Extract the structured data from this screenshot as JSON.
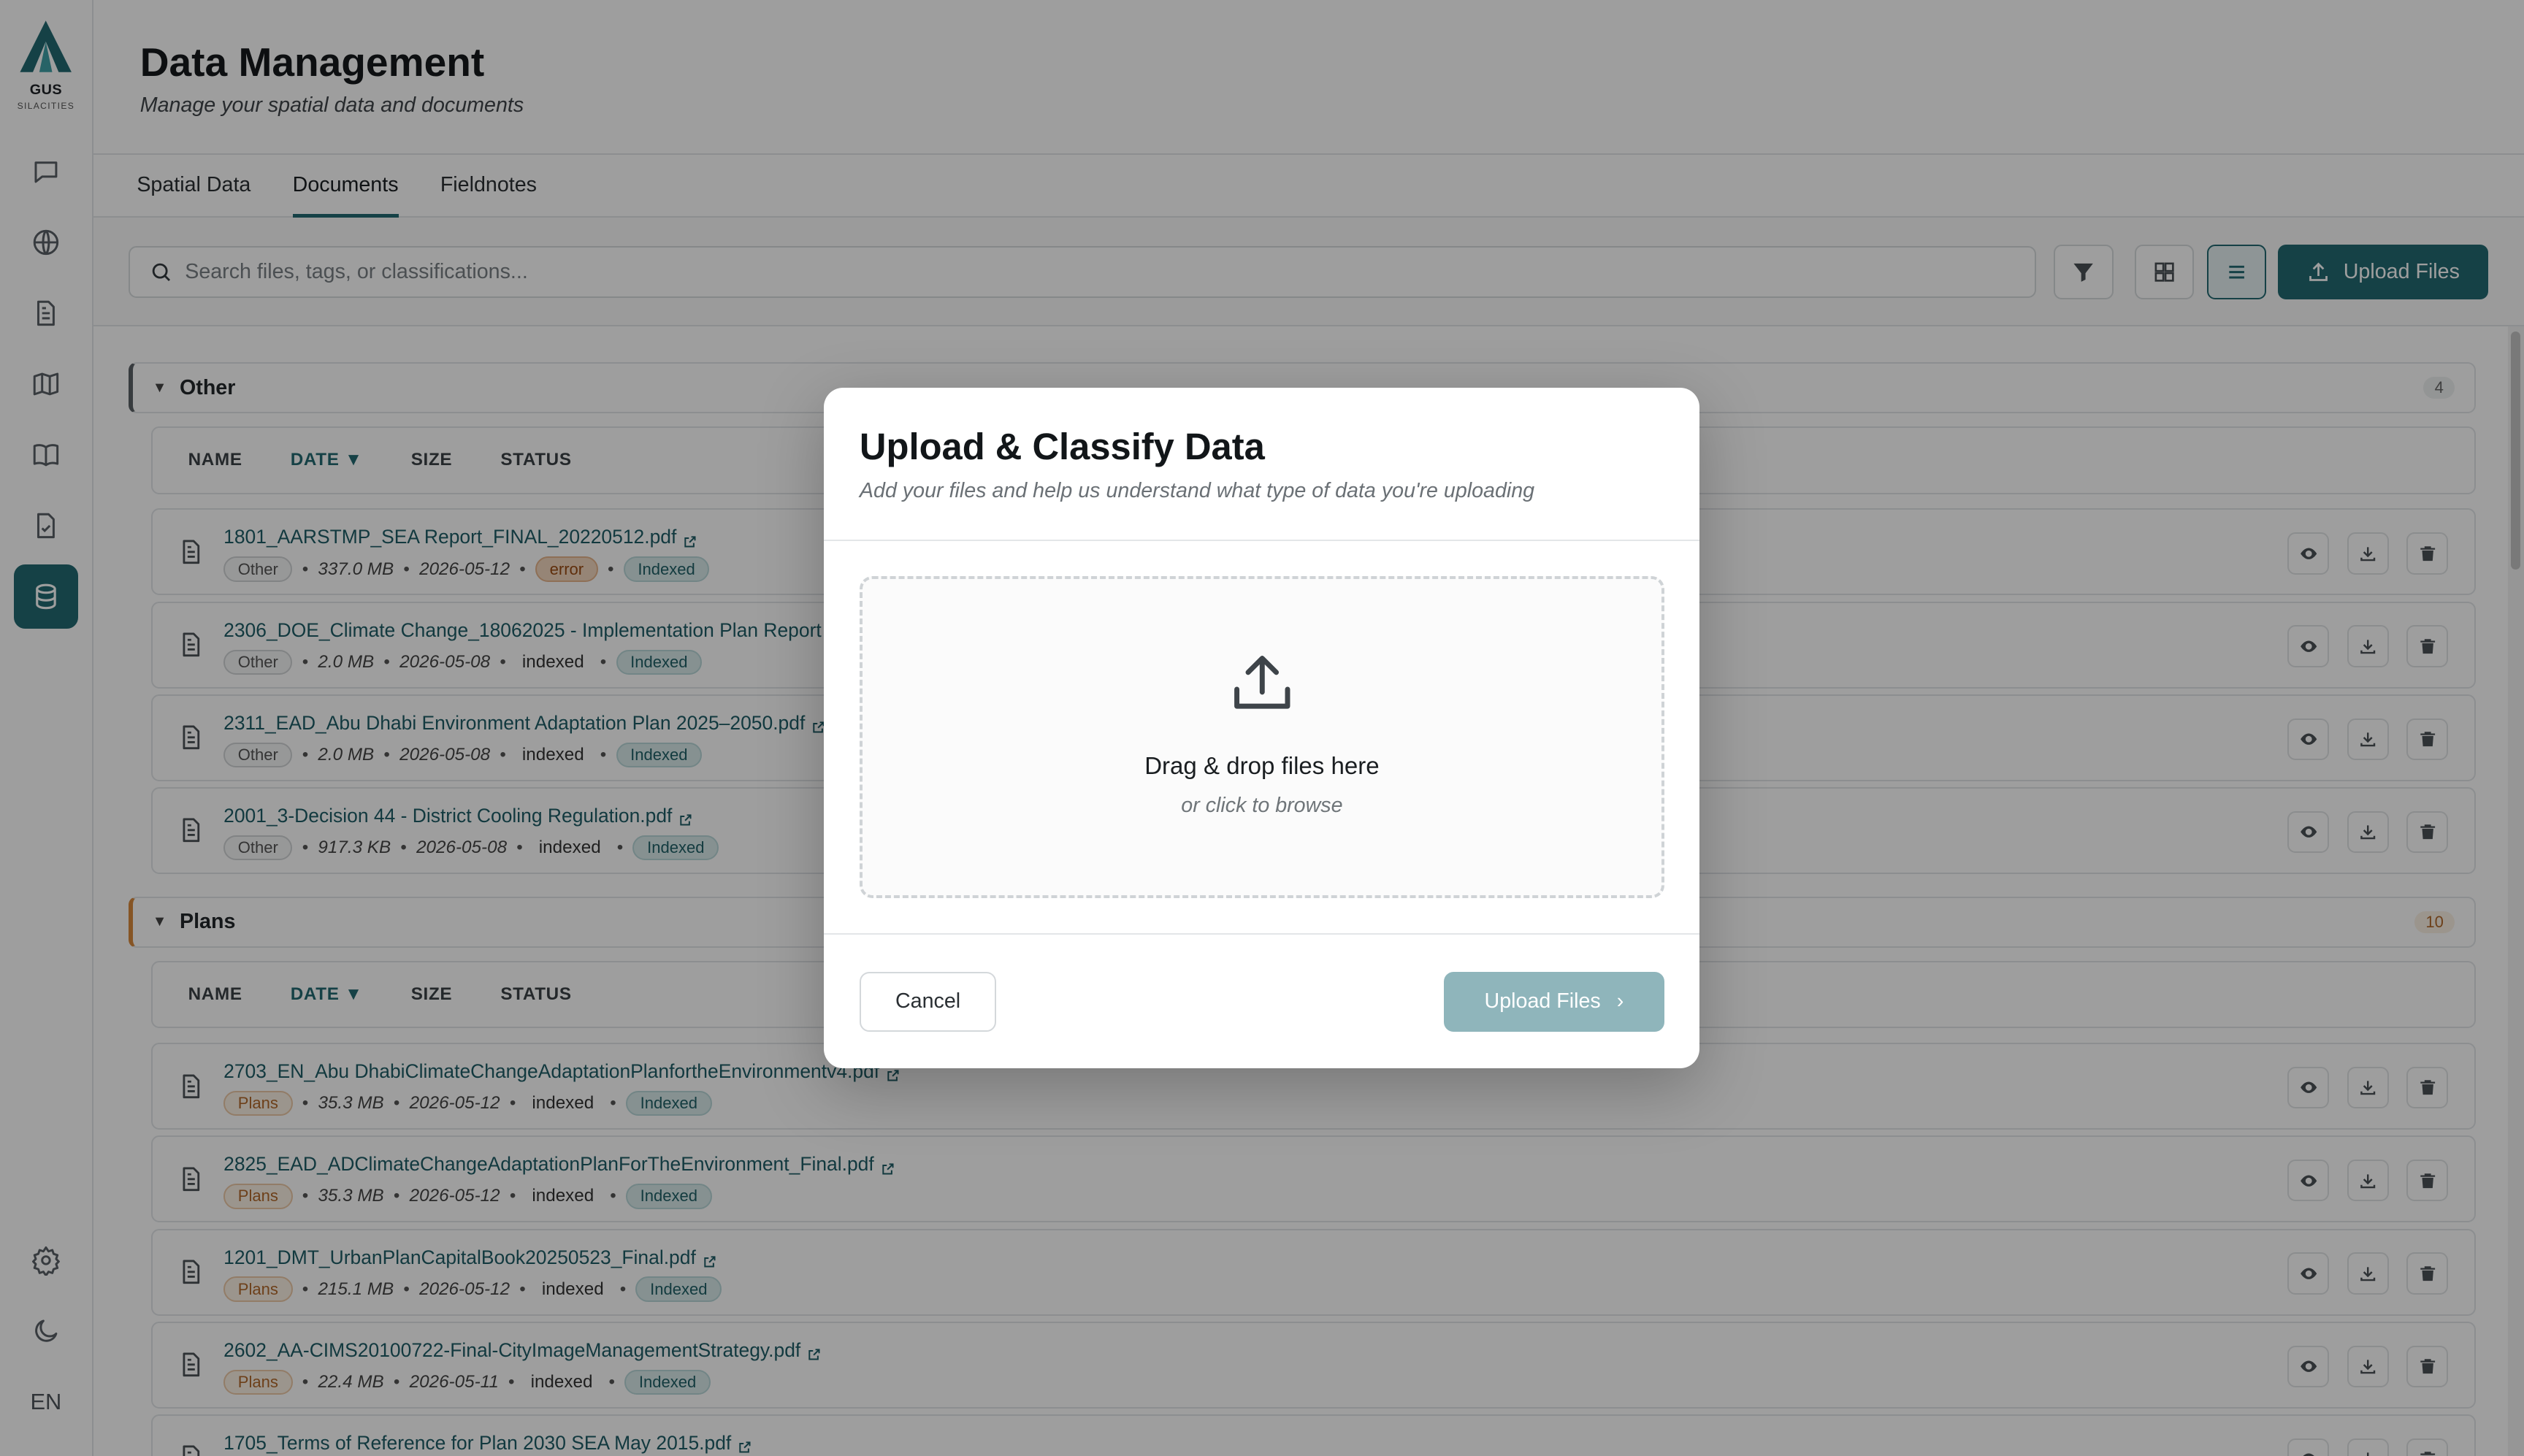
{
  "brand": {
    "name": "GUS",
    "tagline": "SILACITIES"
  },
  "sidebar": {
    "items": [
      {
        "icon": "chat-icon"
      },
      {
        "icon": "globe-icon"
      },
      {
        "icon": "document-icon"
      },
      {
        "icon": "map-icon"
      },
      {
        "icon": "book-icon"
      },
      {
        "icon": "clipboard-check-icon"
      },
      {
        "icon": "database-icon",
        "active": true
      }
    ],
    "bottom": [
      {
        "icon": "gear-icon"
      },
      {
        "icon": "moon-icon"
      }
    ],
    "language": "EN"
  },
  "header": {
    "title": "Data Management",
    "subtitle": "Manage your spatial data and documents"
  },
  "tabs": [
    {
      "label": "Spatial Data"
    },
    {
      "label": "Documents",
      "active": true
    },
    {
      "label": "Fieldnotes"
    }
  ],
  "toolbar": {
    "search_placeholder": "Search files, tags, or classifications...",
    "upload_label": "Upload Files"
  },
  "columns": {
    "name": "NAME",
    "date": "DATE ▼",
    "size": "SIZE",
    "status": "STATUS"
  },
  "groups": [
    {
      "name": "Other",
      "count": "4",
      "accent": "#5b6166",
      "files": [
        {
          "name": "1801_AARSTMP_SEA Report_FINAL_20220512.pdf",
          "tag": "Other",
          "size": "337.0 MB",
          "date": "2026-05-12",
          "status": "error",
          "index": "Indexed"
        },
        {
          "name": "2306_DOE_Climate Change_18062025 - Implementation Plan Report -",
          "tag": "Other",
          "size": "2.0 MB",
          "date": "2026-05-08",
          "status": "indexed",
          "index": "Indexed"
        },
        {
          "name": "2311_EAD_Abu Dhabi Environment Adaptation Plan 2025–2050.pdf",
          "tag": "Other",
          "size": "2.0 MB",
          "date": "2026-05-08",
          "status": "indexed",
          "index": "Indexed"
        },
        {
          "name": "2001_3-Decision 44 - District Cooling Regulation.pdf",
          "tag": "Other",
          "size": "917.3 KB",
          "date": "2026-05-08",
          "status": "indexed",
          "index": "Indexed"
        }
      ]
    },
    {
      "name": "Plans",
      "count": "10",
      "accent": "#d98a3d",
      "files": [
        {
          "name": "2703_EN_Abu DhabiClimateChangeAdaptationPlanfortheEnvironmentv4.pdf",
          "tag": "Plans",
          "size": "35.3 MB",
          "date": "2026-05-12",
          "status": "indexed",
          "index": "Indexed"
        },
        {
          "name": "2825_EAD_ADClimateChangeAdaptationPlanForTheEnvironment_Final.pdf",
          "tag": "Plans",
          "size": "35.3 MB",
          "date": "2026-05-12",
          "status": "indexed",
          "index": "Indexed"
        },
        {
          "name": "1201_DMT_UrbanPlanCapitalBook20250523_Final.pdf",
          "tag": "Plans",
          "size": "215.1 MB",
          "date": "2026-05-12",
          "status": "indexed",
          "index": "Indexed"
        },
        {
          "name": "2602_AA-CIMS20100722-Final-CityImageManagementStrategy.pdf",
          "tag": "Plans",
          "size": "22.4 MB",
          "date": "2026-05-11",
          "status": "indexed",
          "index": "Indexed"
        },
        {
          "name": "1705_Terms of Reference for Plan 2030 SEA May 2015.pdf",
          "tag": "Plans",
          "size": "",
          "date": "",
          "status": "",
          "index": ""
        }
      ]
    }
  ],
  "modal": {
    "title": "Upload & Classify Data",
    "subtitle": "Add your files and help us understand what type of data you're uploading",
    "dropzone_title": "Drag & drop files here",
    "dropzone_sub": "or click to browse",
    "cancel_label": "Cancel",
    "upload_label": "Upload Files",
    "upload_chevron": "›"
  }
}
